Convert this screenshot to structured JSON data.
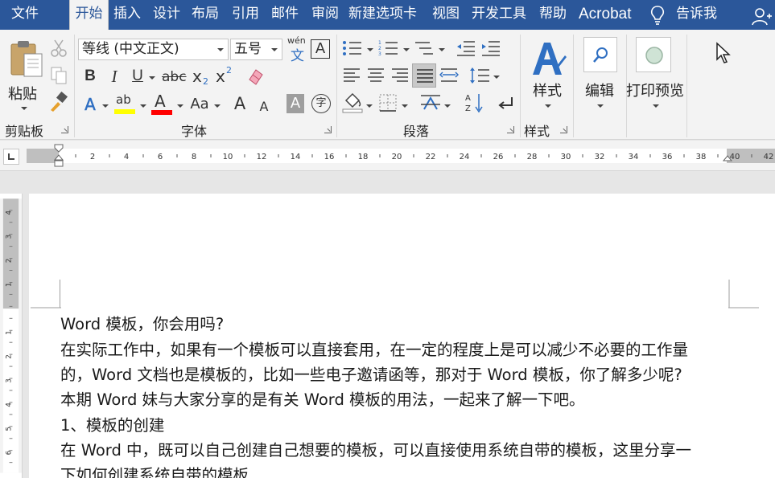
{
  "tabs": [
    {
      "label": "文件",
      "active": false
    },
    {
      "label": "开始",
      "active": true
    },
    {
      "label": "插入",
      "active": false
    },
    {
      "label": "设计",
      "active": false
    },
    {
      "label": "布局",
      "active": false
    },
    {
      "label": "引用",
      "active": false
    },
    {
      "label": "邮件",
      "active": false
    },
    {
      "label": "审阅",
      "active": false
    },
    {
      "label": "新建选项卡",
      "active": false
    },
    {
      "label": "视图",
      "active": false
    },
    {
      "label": "开发工具",
      "active": false
    },
    {
      "label": "帮助",
      "active": false
    },
    {
      "label": "Acrobat",
      "active": false
    }
  ],
  "tell_me": "告诉我",
  "ribbon": {
    "clipboard": {
      "paste_label": "粘贴",
      "group_label": "剪贴板"
    },
    "font": {
      "font_name": "等线 (中文正文)",
      "font_size": "五号",
      "phonetic_top": "wén",
      "phonetic_bottom": "文",
      "border_char": "A",
      "bold": "B",
      "italic": "I",
      "underline": "U",
      "strike": "abc",
      "subscript": "x",
      "subscript_mark": "2",
      "superscript": "x",
      "superscript_mark": "2",
      "effects": "A",
      "highlight": "ab",
      "font_color": "A",
      "change_case": "Aa",
      "grow": "A",
      "shrink": "A",
      "shading": "A",
      "enclose": "字",
      "group_label": "字体"
    },
    "paragraph": {
      "group_label": "段落"
    },
    "styles": {
      "styles_label": "样式",
      "group_label": "样式"
    },
    "editing": {
      "label": "编辑"
    },
    "print_preview": {
      "label": "打印预览"
    }
  },
  "ruler": {
    "h_ticks": [
      "2",
      "4",
      "6",
      "8",
      "10",
      "12",
      "14",
      "16",
      "18",
      "20",
      "22",
      "24",
      "26",
      "28",
      "30",
      "32",
      "34",
      "36",
      "38",
      "40",
      "42"
    ],
    "v_ticks_top": [
      "4",
      "3",
      "2",
      "1"
    ],
    "v_ticks_bottom": [
      "1",
      "2",
      "3",
      "4",
      "5",
      "6"
    ]
  },
  "document": {
    "paragraphs": [
      "Word 模板，你会用吗?",
      "在实际工作中，如果有一个模板可以直接套用，在一定的程度上是可以减少不必要的工作量",
      "的，Word 文档也是模板的，比如一些电子邀请函等，那对于 Word 模板，你了解多少呢?",
      "本期 Word 妹与大家分享的是有关 Word 模板的用法，一起来了解一下吧。",
      "1、模板的创建",
      "在 Word 中，既可以自己创建自己想要的模板，可以直接使用系统自带的模板，这里分享一",
      "下如何创建系统自带的模板"
    ]
  },
  "colors": {
    "title_bar": "#2b579a",
    "ribbon_bg": "#f3f3f3",
    "highlight_yellow": "#ffff00",
    "font_color_red": "#ff0000",
    "accent_blue": "#2f6fc2"
  }
}
